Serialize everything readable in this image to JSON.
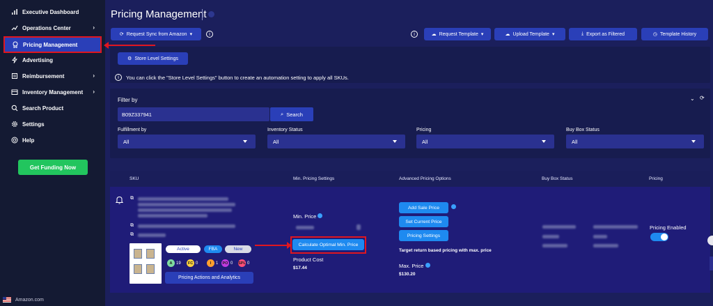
{
  "sidebar": {
    "items": [
      {
        "label": "Executive Dashboard",
        "icon": "bar-chart-icon"
      },
      {
        "label": "Operations Center",
        "icon": "trend-icon",
        "has_children": true
      },
      {
        "label": "Pricing Management",
        "icon": "award-icon",
        "active": true
      },
      {
        "label": "Advertising",
        "icon": "lightning-icon"
      },
      {
        "label": "Reimbursement",
        "icon": "receipt-icon",
        "has_children": true
      },
      {
        "label": "Inventory Management",
        "icon": "box-icon",
        "has_children": true
      },
      {
        "label": "Search Product",
        "icon": "search-icon"
      },
      {
        "label": "Settings",
        "icon": "gear-icon"
      },
      {
        "label": "Help",
        "icon": "lifebuoy-icon"
      }
    ],
    "funding_button": "Get Funding Now",
    "marketplace": "Amazon.com"
  },
  "header": {
    "title": "Pricing Management",
    "sync_button": "Request Sync from Amazon",
    "request_template": "Request Template",
    "upload_template": "Upload Template",
    "export_filtered": "Export as Filtered",
    "template_history": "Template History"
  },
  "store": {
    "button": "Store Level Settings",
    "notice": "You can click the \"Store Level Settings\" button to create an automation setting to apply all SKUs."
  },
  "filters": {
    "title": "Filter by",
    "search_value": "B09Z337941",
    "search_button": "Search",
    "fields": [
      {
        "label": "Fulfillment by",
        "value": "All"
      },
      {
        "label": "Inventory Status",
        "value": "All"
      },
      {
        "label": "Pricing",
        "value": "All"
      },
      {
        "label": "Buy Box Status",
        "value": "All"
      }
    ]
  },
  "table": {
    "headers": [
      "SKU",
      "Min. Pricing Settings",
      "Advanced Pricing Options",
      "Buy Box Status",
      "Pricing"
    ],
    "row": {
      "badges": [
        "Active",
        "FBA",
        "New"
      ],
      "stats": [
        {
          "key": "A",
          "value": "19",
          "color": "#7fdba0"
        },
        {
          "key": "FC",
          "value": "0",
          "color": "#ffd23f"
        },
        {
          "key": "I",
          "value": "1",
          "color": "#ff9f2e"
        },
        {
          "key": "PO",
          "value": "0",
          "color": "#c03be0"
        },
        {
          "key": "SPL",
          "value": "0",
          "color": "#ff4f79"
        }
      ],
      "actions_button": "Pricing Actions and Analytics",
      "min_price_label": "Min. Price",
      "calc_button": "Calculate Optimal Min. Price",
      "product_cost_label": "Product Cost",
      "product_cost_value": "$17.44",
      "add_sale_price": "Add Sale Price",
      "set_current_price": "Set Current Price",
      "pricing_settings": "Pricing Settings",
      "target_text": "Target return based pricing with max. price",
      "max_price_label": "Max. Price",
      "max_price_value": "$130.20",
      "pricing_status": "Pricing Enabled"
    }
  },
  "colors": {
    "background": "#1b1f5c",
    "sidebar": "#141a33",
    "accent": "#2a3fb8",
    "highlight": "#e0161f",
    "funding": "#22c55e",
    "button_blue": "#1e8af0"
  }
}
